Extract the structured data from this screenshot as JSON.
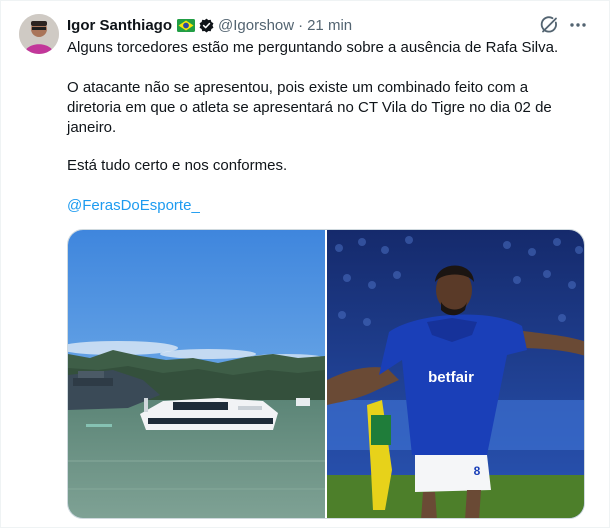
{
  "tweet": {
    "author_name": "Igor Santhiago",
    "flag": "brazil-flag-icon",
    "handle": "@Igorshow",
    "separator": "·",
    "time": "21 min",
    "lines": [
      "Alguns torcedores estão me perguntando sobre a ausência de Rafa Silva.",
      "O atacante não se apresentou, pois existe um combinado feito com a",
      "diretoria em que o atleta se apresentará no CT Vila do Tigre no dia 02 de",
      "janeiro.",
      "Está tudo certo e nos conformes."
    ],
    "mention": "@FerasDoEsporte_",
    "jersey_text": "betfair",
    "jersey_number": "8"
  },
  "colors": {
    "text": "#0f1419",
    "secondary": "#536471",
    "link": "#1d9bf0",
    "jersey_blue": "#1a3fb8"
  }
}
